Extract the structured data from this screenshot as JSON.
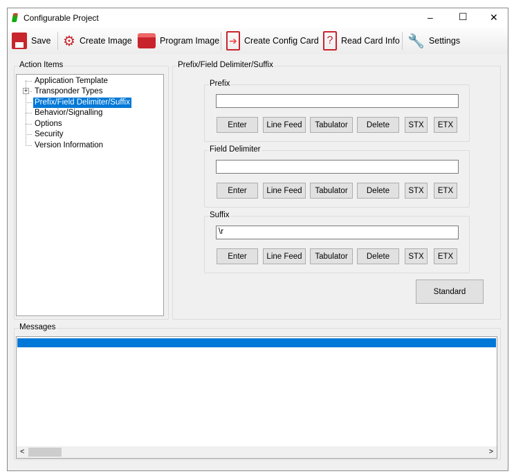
{
  "window": {
    "title": "Configurable Project",
    "minimize": "–",
    "maximize": "☐",
    "close": "✕"
  },
  "toolbar": {
    "items": [
      {
        "label": "Save",
        "icon": "floppy-icon"
      },
      {
        "label": "Create Image",
        "icon": "gears-icon"
      },
      {
        "label": "Program Image",
        "icon": "program-icon"
      },
      {
        "label": "Create Config Card",
        "icon": "card-arrow-icon"
      },
      {
        "label": "Read Card Info",
        "icon": "card-question-icon"
      },
      {
        "label": "Settings",
        "icon": "wrench-icon"
      }
    ]
  },
  "action_items": {
    "label": "Action Items",
    "items": [
      "Application Template",
      "Transponder Types",
      "Prefix/Field Delimiter/Suffix",
      "Behavior/Signalling",
      "Options",
      "Security",
      "Version Information"
    ],
    "selected": "Prefix/Field Delimiter/Suffix",
    "expander": "+"
  },
  "panel": {
    "label": "Prefix/Field Delimiter/Suffix",
    "sections": [
      {
        "label": "Prefix",
        "value": ""
      },
      {
        "label": "Field Delimiter",
        "value": ""
      },
      {
        "label": "Suffix",
        "value": "\\r"
      }
    ],
    "buttons": [
      "Enter",
      "Line Feed",
      "Tabulator",
      "Delete",
      "STX",
      "ETX"
    ],
    "standard": "Standard"
  },
  "messages": {
    "label": "Messages",
    "scroll_left": "<",
    "scroll_right": ">"
  },
  "colors": {
    "accent": "#0078d7",
    "icon_red": "#c8242c"
  }
}
